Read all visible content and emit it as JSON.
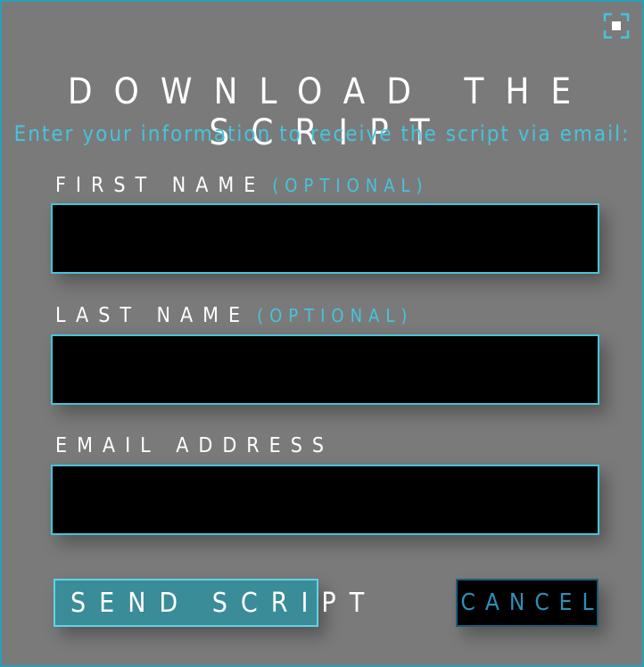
{
  "dialog": {
    "title": "DOWNLOAD THE SCRIPT",
    "subtitle": "Enter your information to receive the script via email:",
    "corner_icon": "fullscreen-icon"
  },
  "fields": {
    "first_name": {
      "label": "FIRST NAME",
      "optional": "(OPTIONAL)",
      "value": ""
    },
    "last_name": {
      "label": "LAST NAME",
      "optional": "(OPTIONAL)",
      "value": ""
    },
    "email": {
      "label": "EMAIL ADDRESS",
      "value": ""
    }
  },
  "buttons": {
    "send": {
      "label": "SEND SCRIPT",
      "icon": "diamond-arrows-icon"
    },
    "cancel": {
      "label": "CANCEL"
    }
  },
  "colors": {
    "background": "#7a7a7a",
    "accent": "#45c4dc",
    "input_bg": "#000000",
    "send_bg": "#3a8c98",
    "cancel_text": "#2e8fb8"
  }
}
